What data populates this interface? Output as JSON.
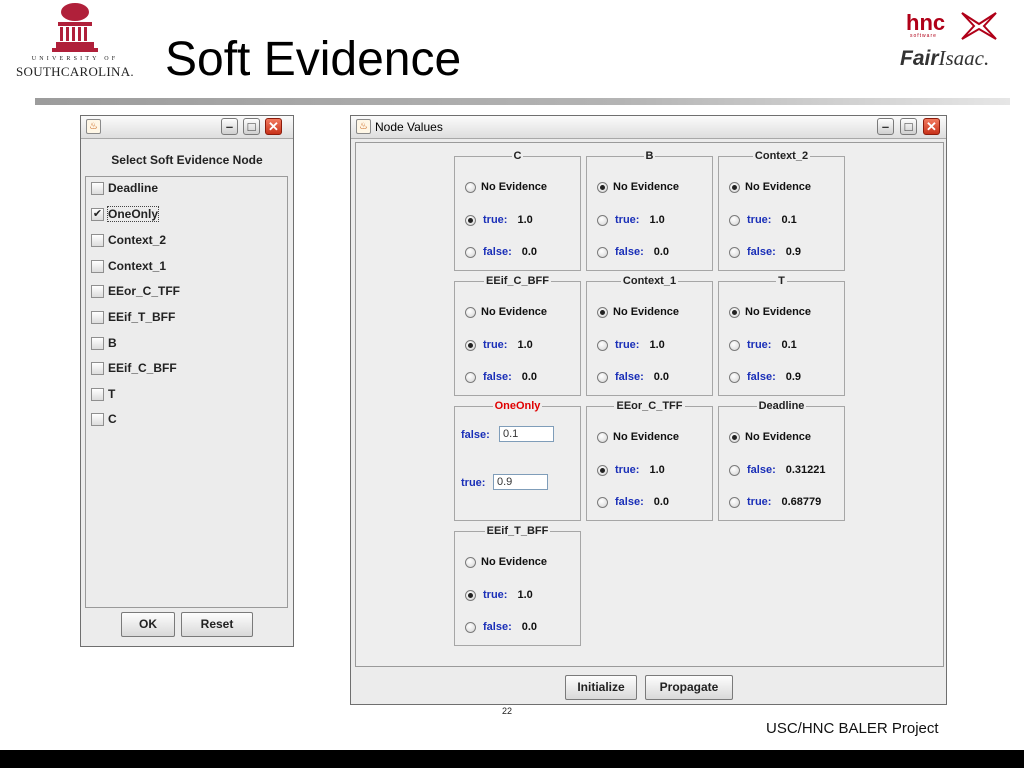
{
  "slide": {
    "title": "Soft Evidence",
    "page_number": "22",
    "footer": "USC/HNC BALER Project"
  },
  "logos": {
    "usc_line1": "UNIVERSITY OF",
    "usc_line2": "SOUTHCAROLINA.",
    "hnc_text": "hnc",
    "hnc_sub": "software",
    "fair_text_bold": "Fair",
    "fair_text_italic": "Isaac."
  },
  "selector_window": {
    "title": "",
    "heading": "Select Soft Evidence Node",
    "items": [
      {
        "label": "Deadline",
        "checked": false
      },
      {
        "label": "OneOnly",
        "checked": true
      },
      {
        "label": "Context_2",
        "checked": false
      },
      {
        "label": "Context_1",
        "checked": false
      },
      {
        "label": "EEor_C_TFF",
        "checked": false
      },
      {
        "label": "EEif_T_BFF",
        "checked": false
      },
      {
        "label": "B",
        "checked": false
      },
      {
        "label": "EEif_C_BFF",
        "checked": false
      },
      {
        "label": "T",
        "checked": false
      },
      {
        "label": "C",
        "checked": false
      }
    ],
    "ok_label": "OK",
    "reset_label": "Reset"
  },
  "node_window": {
    "title": "Node Values",
    "groups": {
      "c": {
        "title": "C",
        "no_evidence": "No Evidence",
        "selected": "true",
        "r1_state": "true:",
        "r1_value": "1.0",
        "r2_state": "false:",
        "r2_value": "0.0"
      },
      "b": {
        "title": "B",
        "no_evidence": "No Evidence",
        "selected": "none",
        "r1_state": "true:",
        "r1_value": "1.0",
        "r2_state": "false:",
        "r2_value": "0.0"
      },
      "context_2": {
        "title": "Context_2",
        "no_evidence": "No Evidence",
        "selected": "none",
        "r1_state": "true:",
        "r1_value": "0.1",
        "r2_state": "false:",
        "r2_value": "0.9"
      },
      "eeif_c_bff": {
        "title": "EEif_C_BFF",
        "no_evidence": "No Evidence",
        "selected": "true",
        "r1_state": "true:",
        "r1_value": "1.0",
        "r2_state": "false:",
        "r2_value": "0.0"
      },
      "context_1": {
        "title": "Context_1",
        "no_evidence": "No Evidence",
        "selected": "none",
        "r1_state": "true:",
        "r1_value": "1.0",
        "r2_state": "false:",
        "r2_value": "0.0"
      },
      "t": {
        "title": "T",
        "no_evidence": "No Evidence",
        "selected": "none",
        "r1_state": "true:",
        "r1_value": "0.1",
        "r2_state": "false:",
        "r2_value": "0.9"
      },
      "eeor_c_tff": {
        "title": "EEor_C_TFF",
        "no_evidence": "No Evidence",
        "selected": "true",
        "r1_state": "true:",
        "r1_value": "1.0",
        "r2_state": "false:",
        "r2_value": "0.0"
      },
      "deadline": {
        "title": "Deadline",
        "no_evidence": "No Evidence",
        "selected": "none",
        "r1_state": "false:",
        "r1_value": "0.31221",
        "r2_state": "true:",
        "r2_value": "0.68779"
      },
      "eeif_t_bff": {
        "title": "EEif_T_BFF",
        "no_evidence": "No Evidence",
        "selected": "true",
        "r1_state": "true:",
        "r1_value": "1.0",
        "r2_state": "false:",
        "r2_value": "0.0"
      }
    },
    "oneonly": {
      "title": "OneOnly",
      "false_label": "false:",
      "false_value": "0.1",
      "true_label": "true:",
      "true_value": "0.9"
    },
    "initialize_label": "Initialize",
    "propagate_label": "Propagate"
  }
}
